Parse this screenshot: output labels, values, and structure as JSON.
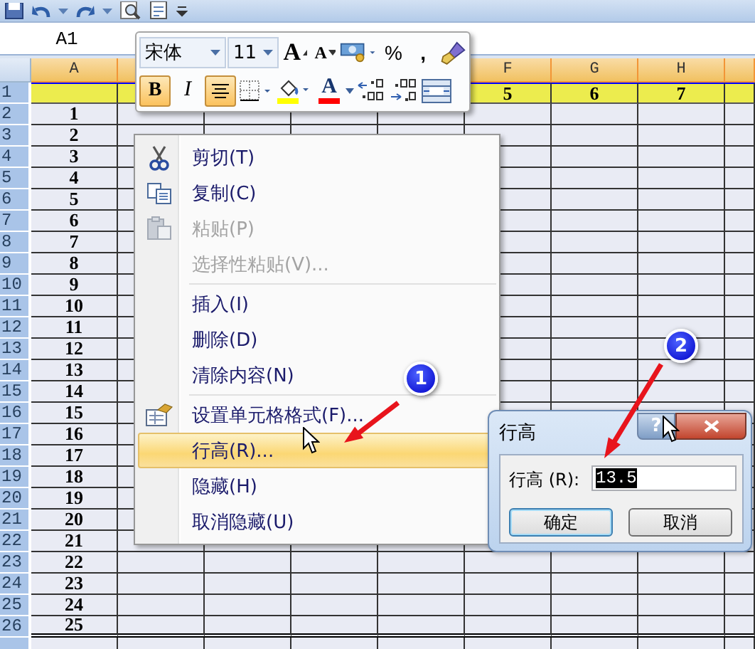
{
  "name_box": "A1",
  "column_headers": [
    "A",
    "F",
    "G",
    "H"
  ],
  "rows": [
    {
      "header": "1",
      "selected": true,
      "cells": [
        null,
        null,
        null,
        null,
        null,
        "5",
        "6",
        "7",
        null
      ]
    },
    {
      "header": "2",
      "selected": false,
      "cells": [
        "1"
      ]
    },
    {
      "header": "3",
      "selected": false,
      "cells": [
        "2"
      ]
    },
    {
      "header": "4",
      "selected": false,
      "cells": [
        "3"
      ]
    },
    {
      "header": "5",
      "selected": false,
      "cells": [
        "4"
      ]
    },
    {
      "header": "6",
      "selected": false,
      "cells": [
        "5"
      ]
    },
    {
      "header": "7",
      "selected": false,
      "cells": [
        "6"
      ]
    },
    {
      "header": "8",
      "selected": false,
      "cells": [
        "7"
      ]
    },
    {
      "header": "9",
      "selected": false,
      "cells": [
        "8"
      ]
    },
    {
      "header": "10",
      "selected": false,
      "cells": [
        "9"
      ]
    },
    {
      "header": "11",
      "selected": false,
      "cells": [
        "10"
      ]
    },
    {
      "header": "12",
      "selected": false,
      "cells": [
        "11"
      ]
    },
    {
      "header": "13",
      "selected": false,
      "cells": [
        "12"
      ]
    },
    {
      "header": "14",
      "selected": false,
      "cells": [
        "13"
      ]
    },
    {
      "header": "15",
      "selected": false,
      "cells": [
        "14"
      ]
    },
    {
      "header": "16",
      "selected": false,
      "cells": [
        "15"
      ]
    },
    {
      "header": "17",
      "selected": false,
      "cells": [
        "16"
      ]
    },
    {
      "header": "18",
      "selected": false,
      "cells": [
        "17"
      ]
    },
    {
      "header": "19",
      "selected": false,
      "cells": [
        "18"
      ]
    },
    {
      "header": "20",
      "selected": false,
      "cells": [
        "19"
      ]
    },
    {
      "header": "21",
      "selected": false,
      "cells": [
        "20"
      ]
    },
    {
      "header": "22",
      "selected": false,
      "cells": [
        "21"
      ]
    },
    {
      "header": "23",
      "selected": false,
      "cells": [
        "22"
      ]
    },
    {
      "header": "24",
      "selected": false,
      "cells": [
        "23"
      ]
    },
    {
      "header": "25",
      "selected": false,
      "cells": [
        "24"
      ]
    },
    {
      "header": "26",
      "selected": false,
      "cells": [
        "25"
      ]
    }
  ],
  "mini_toolbar": {
    "rows": [
      [
        {
          "kind": "font",
          "value": "宋体"
        },
        {
          "kind": "size",
          "value": "11"
        },
        {
          "kind": "grow-font",
          "label": "A"
        },
        {
          "kind": "shrink-font",
          "label": "A"
        },
        {
          "kind": "currency"
        },
        {
          "kind": "percent",
          "label": "%"
        },
        {
          "kind": "comma",
          "label": ","
        },
        {
          "kind": "painter"
        }
      ],
      [
        {
          "kind": "bold",
          "label": "B",
          "selected": true
        },
        {
          "kind": "italic",
          "label": "I",
          "selected": false
        },
        {
          "kind": "center",
          "selected": true
        },
        {
          "kind": "borders"
        },
        {
          "kind": "fill-color",
          "color": "#ffff00"
        },
        {
          "kind": "font-color",
          "label": "A",
          "color": "#ff0000"
        },
        {
          "kind": "increase-decimal"
        },
        {
          "kind": "decrease-decimal"
        },
        {
          "kind": "merge"
        }
      ]
    ]
  },
  "context_menu": {
    "items": [
      {
        "kind": "item",
        "label": "剪切(T)",
        "disabled": false,
        "selected": false
      },
      {
        "kind": "item",
        "label": "复制(C)",
        "disabled": false,
        "selected": false
      },
      {
        "kind": "item",
        "label": "粘贴(P)",
        "disabled": true,
        "selected": false
      },
      {
        "kind": "item",
        "label": "选择性粘贴(V)...",
        "disabled": true,
        "selected": false
      },
      {
        "kind": "separator"
      },
      {
        "kind": "item",
        "label": "插入(I)",
        "disabled": false,
        "selected": false
      },
      {
        "kind": "item",
        "label": "删除(D)",
        "disabled": false,
        "selected": false
      },
      {
        "kind": "item",
        "label": "清除内容(N)",
        "disabled": false,
        "selected": false
      },
      {
        "kind": "separator"
      },
      {
        "kind": "item",
        "label": "设置单元格格式(F)...",
        "disabled": false,
        "selected": false
      },
      {
        "kind": "item",
        "label": "行高(R)...",
        "disabled": false,
        "selected": true
      },
      {
        "kind": "item",
        "label": "隐藏(H)",
        "disabled": false,
        "selected": false
      },
      {
        "kind": "item",
        "label": "取消隐藏(U)",
        "disabled": false,
        "selected": false
      }
    ]
  },
  "dialog": {
    "title": "行高",
    "help": "?",
    "label": "行高 (R):",
    "value": "13.5",
    "value_selected": true,
    "buttons": [
      {
        "label": "确定",
        "focused": true
      },
      {
        "label": "取消",
        "focused": false
      }
    ]
  },
  "callouts": [
    {
      "label": "1"
    },
    {
      "label": "2"
    }
  ]
}
